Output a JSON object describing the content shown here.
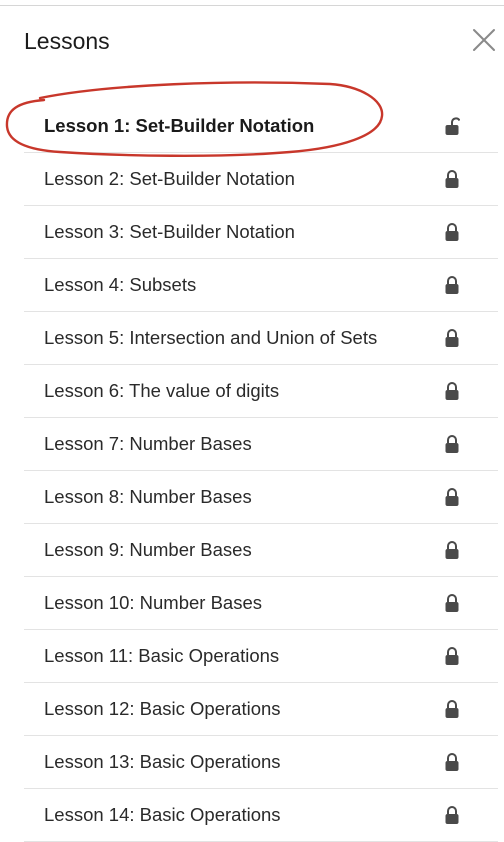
{
  "header": {
    "title": "Lessons",
    "close_icon": "close-icon"
  },
  "colors": {
    "annotation": "#c8372b",
    "lock": "#4a4a4a",
    "divider": "#e3e3e3"
  },
  "lessons": [
    {
      "label": "Lesson 1: Set-Builder Notation",
      "icon": "unlock-icon",
      "active": true
    },
    {
      "label": "Lesson 2: Set-Builder Notation",
      "icon": "lock-icon"
    },
    {
      "label": "Lesson 3: Set-Builder Notation",
      "icon": "lock-icon"
    },
    {
      "label": "Lesson 4: Subsets",
      "icon": "lock-icon"
    },
    {
      "label": "Lesson 5: Intersection and Union of Sets",
      "icon": "lock-icon"
    },
    {
      "label": "Lesson 6: The value of digits",
      "icon": "lock-icon"
    },
    {
      "label": "Lesson 7: Number Bases",
      "icon": "lock-icon"
    },
    {
      "label": "Lesson 8: Number Bases",
      "icon": "lock-icon"
    },
    {
      "label": "Lesson 9: Number Bases",
      "icon": "lock-icon"
    },
    {
      "label": "Lesson 10: Number Bases",
      "icon": "lock-icon"
    },
    {
      "label": "Lesson 11: Basic Operations",
      "icon": "lock-icon"
    },
    {
      "label": "Lesson 12: Basic Operations",
      "icon": "lock-icon"
    },
    {
      "label": "Lesson 13: Basic Operations",
      "icon": "lock-icon"
    },
    {
      "label": "Lesson 14: Basic Operations",
      "icon": "lock-icon"
    }
  ]
}
